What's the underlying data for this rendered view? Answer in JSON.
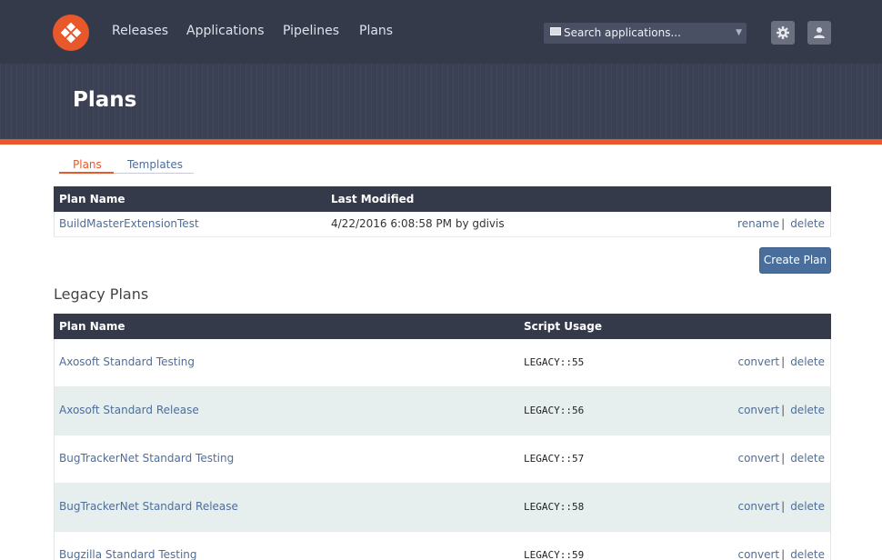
{
  "nav": {
    "items": [
      {
        "label": "Releases"
      },
      {
        "label": "Applications"
      },
      {
        "label": "Pipelines"
      },
      {
        "label": "Plans"
      }
    ],
    "search_placeholder": "Search applications...",
    "settings_icon": "gear-icon",
    "user_icon": "user-icon"
  },
  "page": {
    "title": "Plans"
  },
  "tabs": [
    {
      "label": "Plans",
      "active": true
    },
    {
      "label": "Templates",
      "active": false
    }
  ],
  "plans_table": {
    "headers": {
      "name": "Plan Name",
      "modified": "Last Modified"
    },
    "rows": [
      {
        "name": "BuildMasterExtensionTest",
        "modified": "4/22/2016 6:08:58 PM by gdivis",
        "action1": "rename",
        "sep": "|",
        "action2": "delete"
      }
    ]
  },
  "create_button": "Create Plan",
  "legacy": {
    "title": "Legacy Plans",
    "headers": {
      "name": "Plan Name",
      "usage": "Script Usage"
    },
    "rows": [
      {
        "name": "Axosoft Standard Testing",
        "usage": "LEGACY::55",
        "action1": "convert",
        "sep": "|",
        "action2": "delete"
      },
      {
        "name": "Axosoft Standard Release",
        "usage": "LEGACY::56",
        "action1": "convert",
        "sep": "|",
        "action2": "delete"
      },
      {
        "name": "BugTrackerNet Standard Testing",
        "usage": "LEGACY::57",
        "action1": "convert",
        "sep": "|",
        "action2": "delete"
      },
      {
        "name": "BugTrackerNet Standard Release",
        "usage": "LEGACY::58",
        "action1": "convert",
        "sep": "|",
        "action2": "delete"
      },
      {
        "name": "Bugzilla Standard Testing",
        "usage": "LEGACY::59",
        "action1": "convert",
        "sep": "|",
        "action2": "delete"
      }
    ]
  },
  "colors": {
    "nav_bg": "#353a4b",
    "accent": "#e8582a",
    "link": "#4e6e9a",
    "stripe": "#e6eeee"
  }
}
